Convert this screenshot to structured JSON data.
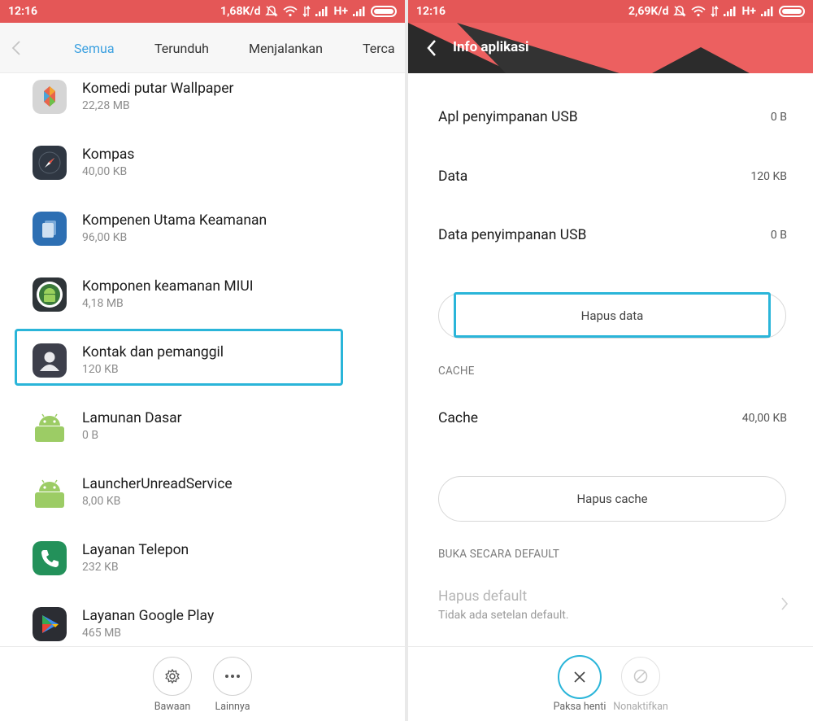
{
  "left": {
    "status": {
      "time": "12:16",
      "speed": "1,68K/d",
      "network": "H+"
    },
    "tabs": [
      {
        "label": "Semua",
        "active": true
      },
      {
        "label": "Terunduh",
        "active": false
      },
      {
        "label": "Menjalankan",
        "active": false
      },
      {
        "label": "Tercac",
        "active": false
      }
    ],
    "apps": [
      {
        "name": "Komedi putar Wallpaper",
        "size": "22,28 MB",
        "icon": "wallpaper-carousel-icon"
      },
      {
        "name": "Kompas",
        "size": "40,00 KB",
        "icon": "compass-icon"
      },
      {
        "name": "Kompenen Utama Keamanan",
        "size": "96,00 KB",
        "icon": "security-core-icon"
      },
      {
        "name": "Komponen keamanan MIUI",
        "size": "4,18 MB",
        "icon": "android-security-icon"
      },
      {
        "name": "Kontak dan pemanggil",
        "size": "120 KB",
        "icon": "contacts-icon"
      },
      {
        "name": "Lamunan Dasar",
        "size": "0 B",
        "icon": "android-icon"
      },
      {
        "name": "LauncherUnreadService",
        "size": "8,00 KB",
        "icon": "android-icon"
      },
      {
        "name": "Layanan Telepon",
        "size": "232 KB",
        "icon": "phone-icon"
      },
      {
        "name": "Layanan Google Play",
        "size": "465 MB",
        "icon": "google-play-services-icon"
      }
    ],
    "bottom": {
      "defaults_label": "Bawaan",
      "more_label": "Lainnya"
    }
  },
  "right": {
    "status": {
      "time": "12:16",
      "speed": "2,69K/d",
      "network": "H+"
    },
    "header_title": "Info aplikasi",
    "rows": [
      {
        "label": "Apl penyimpanan USB",
        "value": "0 B"
      },
      {
        "label": "Data",
        "value": "120 KB"
      },
      {
        "label": "Data penyimpanan USB",
        "value": "0 B"
      }
    ],
    "clear_data_label": "Hapus data",
    "cache_section": "CACHE",
    "cache_row": {
      "label": "Cache",
      "value": "40,00 KB"
    },
    "clear_cache_label": "Hapus cache",
    "default_section": "BUKA SECARA DEFAULT",
    "clear_defaults_title": "Hapus default",
    "clear_defaults_sub": "Tidak ada setelan default.",
    "bottom": {
      "force_stop_label": "Paksa henti",
      "disable_label": "Nonaktifkan"
    }
  },
  "colors": {
    "status_bar": "#e45757",
    "accent": "#3ba0e0",
    "highlight": "#2ab5d9",
    "header": "#ec6060"
  }
}
